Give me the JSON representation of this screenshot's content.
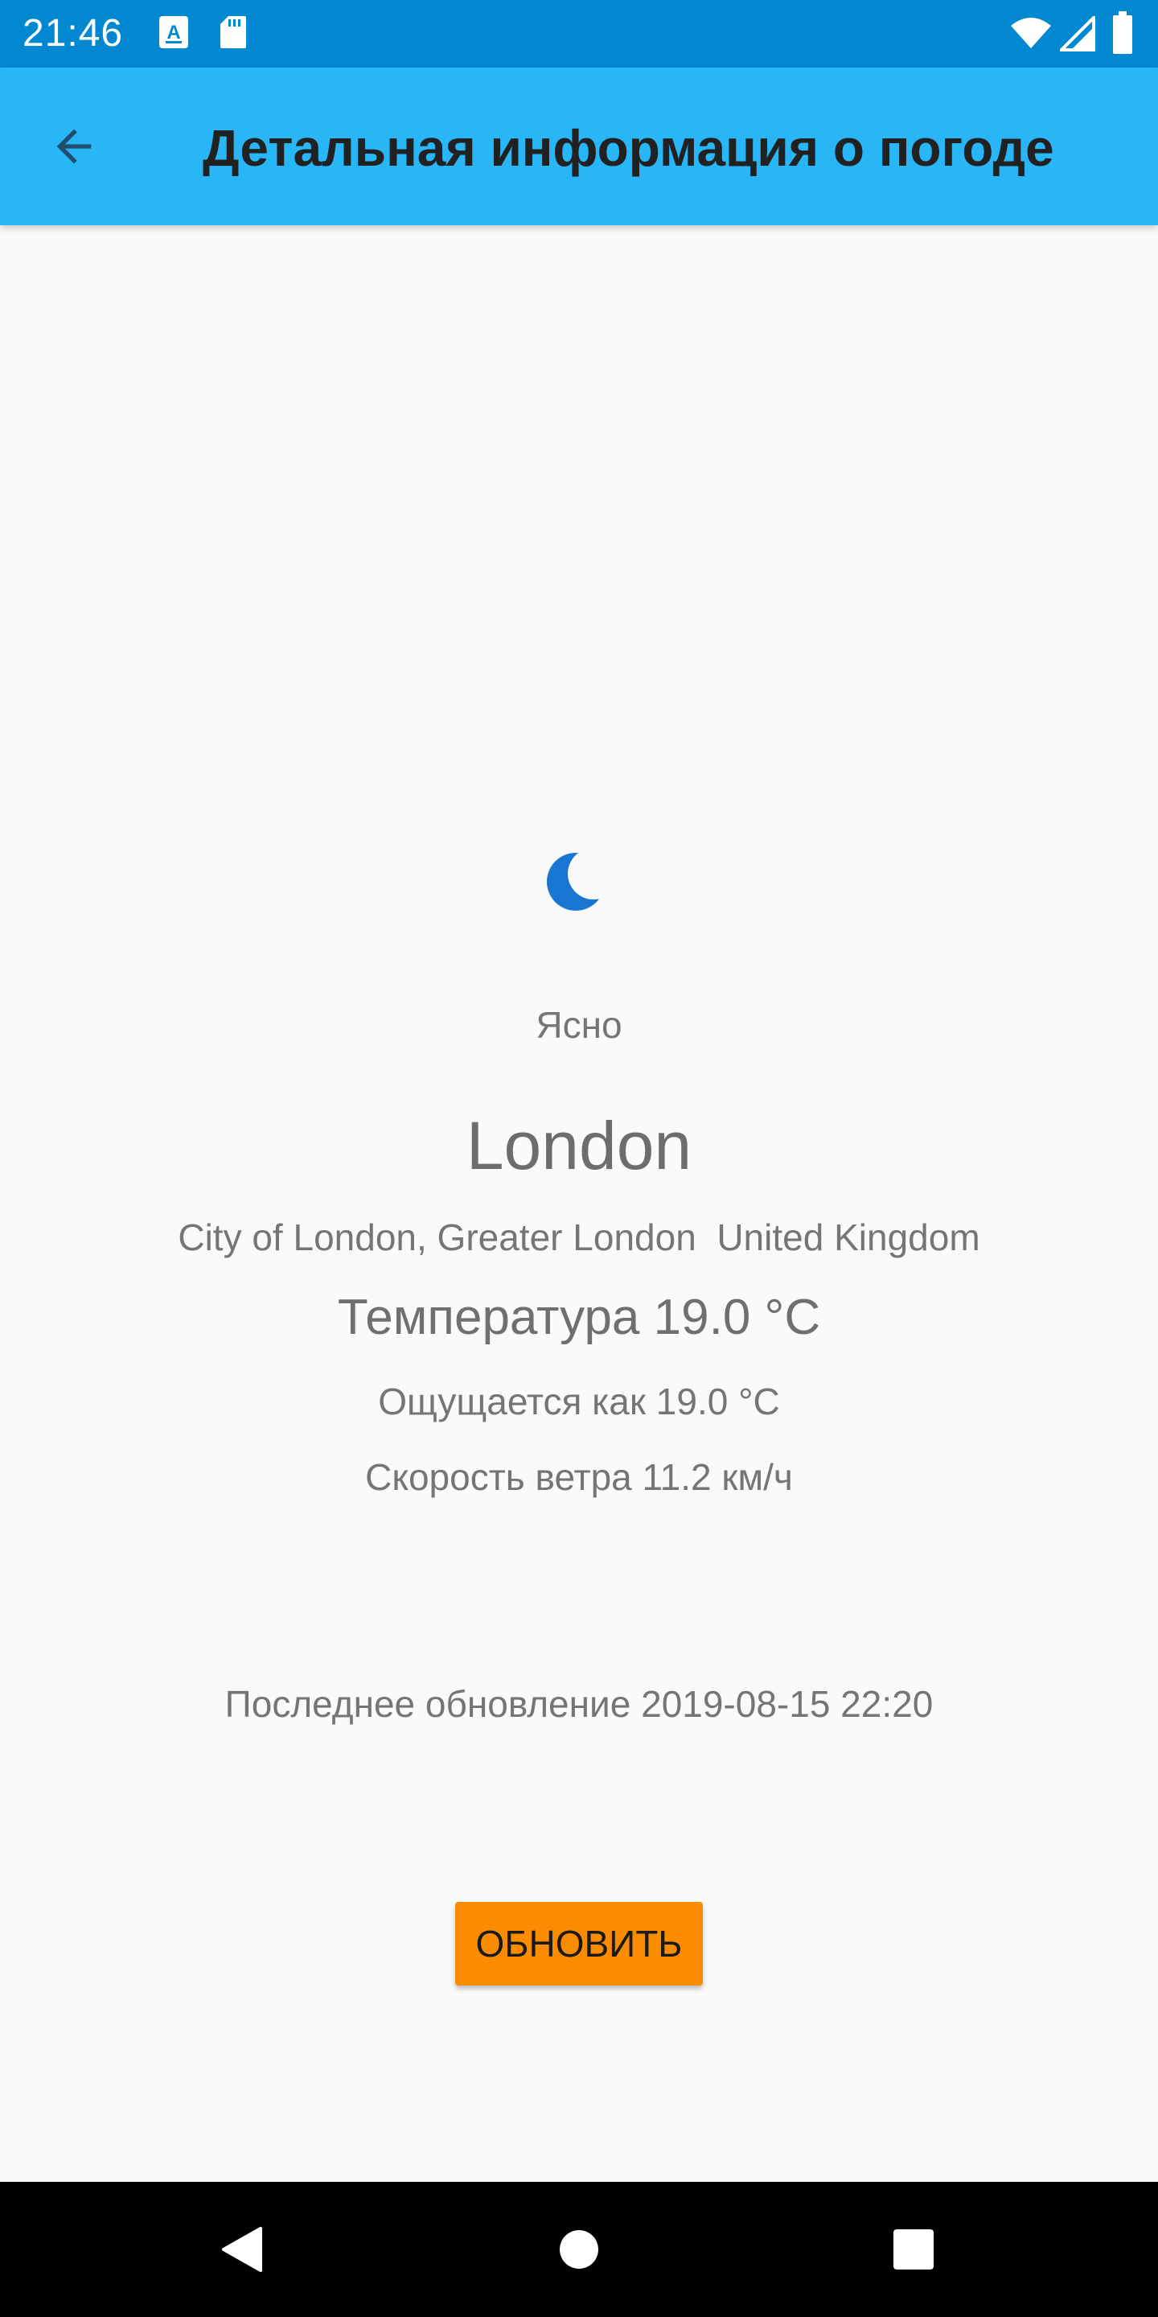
{
  "status_bar": {
    "time": "21:46",
    "icons": [
      "text-a-icon",
      "sd-card-icon",
      "wifi-icon",
      "signal-icon",
      "battery-icon"
    ]
  },
  "app_bar": {
    "back_icon": "arrow-back-icon",
    "title": "Детальная информация о погоде"
  },
  "weather": {
    "icon": "crescent-moon-icon",
    "condition": "Ясно",
    "city": "London",
    "region": "City of London, Greater London  United Kingdom",
    "temperature": "Температура 19.0 °C",
    "feels_like": "Ощущается как 19.0 °C",
    "wind": "Скорость ветра 11.2 км/ч",
    "last_updated": "Последнее обновление 2019-08-15 22:20"
  },
  "actions": {
    "refresh_label": "ОБНОВИТЬ"
  },
  "nav_bar": {
    "buttons": [
      "back-triangle-icon",
      "home-circle-icon",
      "recents-square-icon"
    ]
  },
  "colors": {
    "status_bar": "#0288d1",
    "app_bar": "#29b6f6",
    "background": "#fafafa",
    "accent_button": "#fb8c00",
    "moon_icon": "#1976d2",
    "text_secondary": "#757575"
  }
}
